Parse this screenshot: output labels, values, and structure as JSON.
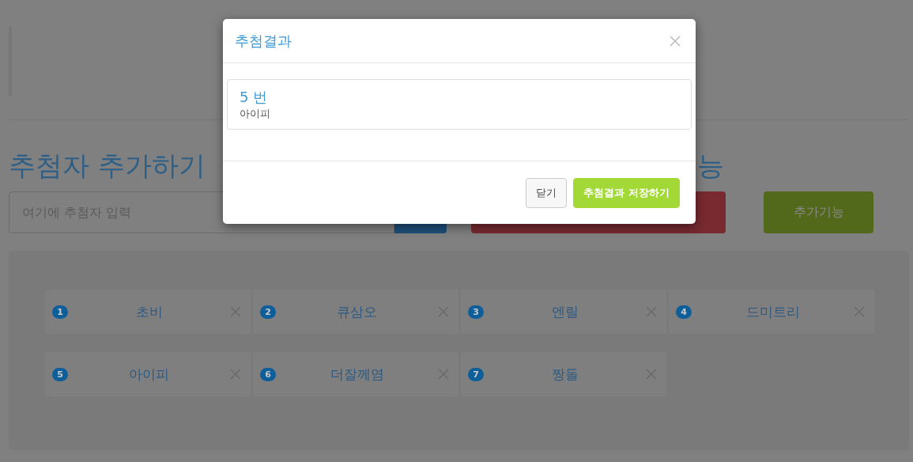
{
  "page": {
    "heading": "추첨자 추가하기",
    "second_heading": "능",
    "entry_field": {
      "placeholder": "여기에 추첨자 입력"
    },
    "extra_button": "추가기능"
  },
  "candidates": [
    {
      "number": "1",
      "name": "초비"
    },
    {
      "number": "2",
      "name": "큐삼오"
    },
    {
      "number": "3",
      "name": "엔릴"
    },
    {
      "number": "4",
      "name": "드미트리"
    },
    {
      "number": "5",
      "name": "아이피"
    },
    {
      "number": "6",
      "name": "더잘께염"
    },
    {
      "number": "7",
      "name": "짱돌"
    }
  ],
  "modal": {
    "title": "추첨결과",
    "result": {
      "number": "5 번",
      "name": "아이피"
    },
    "buttons": [
      {
        "label": "닫기",
        "kind": "default"
      },
      {
        "label": "추첨결과 저장하기",
        "kind": "primary"
      }
    ]
  }
}
